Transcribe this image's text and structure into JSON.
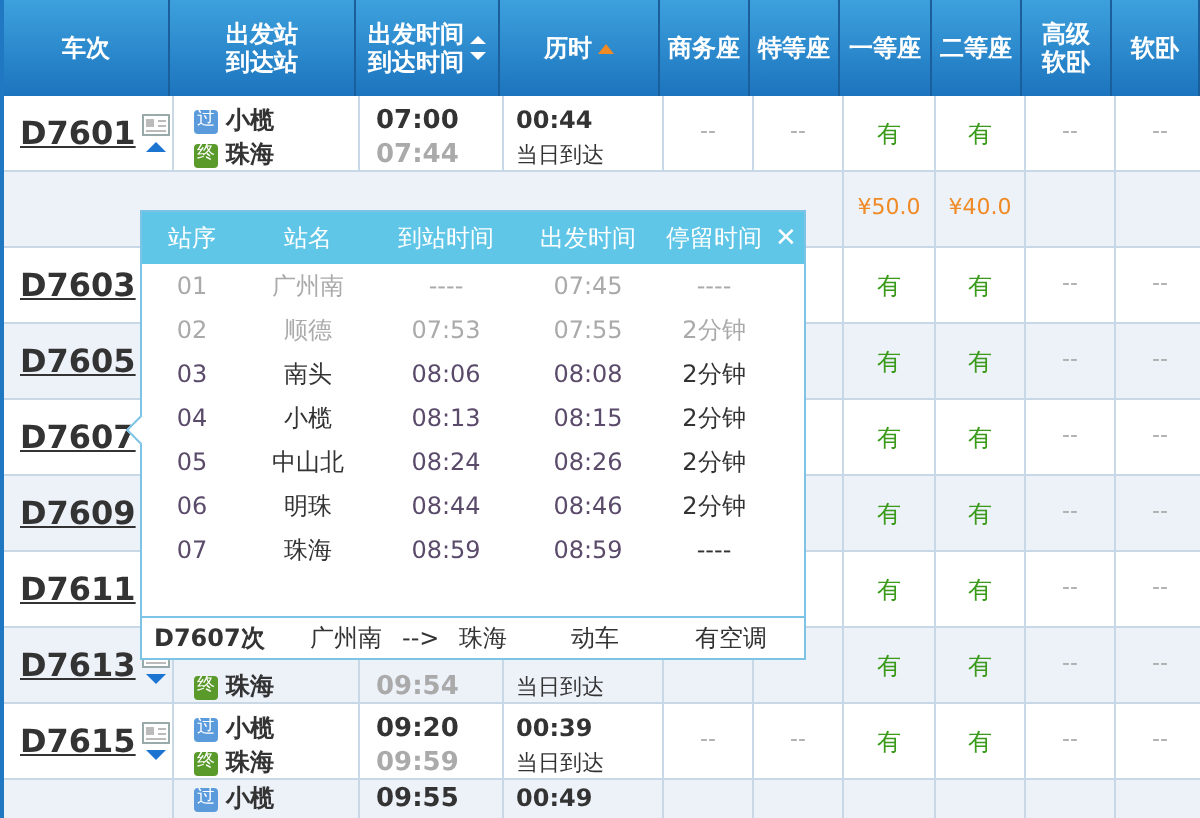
{
  "columns": [
    {
      "lines": [
        "车次"
      ]
    },
    {
      "lines": [
        "出发站",
        "到达站"
      ]
    },
    {
      "lines": [
        "出发时间",
        "到达时间"
      ],
      "sortable": true,
      "sort_active": false
    },
    {
      "lines": [
        "历时"
      ],
      "sortable": true,
      "sort_active": true
    },
    {
      "lines": [
        "商务座"
      ]
    },
    {
      "lines": [
        "特等座"
      ]
    },
    {
      "lines": [
        "一等座"
      ]
    },
    {
      "lines": [
        "二等座"
      ]
    },
    {
      "lines": [
        "高级",
        "软卧"
      ]
    },
    {
      "lines": [
        "软卧"
      ]
    }
  ],
  "rows": [
    {
      "kind": "train",
      "train": "D7601",
      "expanded": true,
      "from_badge": "过",
      "from": "小榄",
      "to_badge": "终",
      "to": "珠海",
      "depart": "07:00",
      "arrive": "07:44",
      "duration": "00:44",
      "arrival_day": "当日到达",
      "seats": [
        "--",
        "--",
        "有",
        "有",
        "--",
        "--"
      ]
    },
    {
      "kind": "price",
      "first_class": "¥50.0",
      "second_class": "¥40.0"
    },
    {
      "kind": "train",
      "train": "D7603",
      "seats": [
        "有",
        "有",
        "--",
        "--"
      ]
    },
    {
      "kind": "train",
      "train": "D7605",
      "seats": [
        "有",
        "有",
        "--",
        "--"
      ]
    },
    {
      "kind": "train",
      "train": "D7607",
      "seats": [
        "有",
        "有",
        "--",
        "--"
      ]
    },
    {
      "kind": "train",
      "train": "D7609",
      "seats": [
        "有",
        "有",
        "--",
        "--"
      ]
    },
    {
      "kind": "train",
      "train": "D7611",
      "seats": [
        "有",
        "有",
        "--",
        "--"
      ]
    },
    {
      "kind": "train",
      "train": "D7613",
      "to_badge": "终",
      "to": "珠海",
      "arrive": "09:54",
      "arrival_day": "当日到达",
      "seats": [
        "有",
        "有",
        "--",
        "--"
      ]
    },
    {
      "kind": "train",
      "train": "D7615",
      "expanded": false,
      "from_badge": "过",
      "from": "小榄",
      "to_badge": "终",
      "to": "珠海",
      "depart": "09:20",
      "arrive": "09:59",
      "duration": "00:39",
      "arrival_day": "当日到达",
      "seats": [
        "--",
        "--",
        "有",
        "有",
        "--",
        "--"
      ]
    },
    {
      "kind": "partial",
      "from_badge": "过",
      "from": "小榄",
      "depart": "09:55",
      "duration": "00:49"
    }
  ],
  "stops_popup": {
    "columns": [
      "站序",
      "站名",
      "到站时间",
      "出发时间",
      "停留时间"
    ],
    "close": "✕",
    "stops": [
      {
        "no": "01",
        "station": "广州南",
        "arrive": "----",
        "depart": "07:45",
        "stay": "----",
        "passed": true
      },
      {
        "no": "02",
        "station": "顺德",
        "arrive": "07:53",
        "depart": "07:55",
        "stay": "2分钟",
        "passed": true
      },
      {
        "no": "03",
        "station": "南头",
        "arrive": "08:06",
        "depart": "08:08",
        "stay": "2分钟",
        "passed": false
      },
      {
        "no": "04",
        "station": "小榄",
        "arrive": "08:13",
        "depart": "08:15",
        "stay": "2分钟",
        "passed": false
      },
      {
        "no": "05",
        "station": "中山北",
        "arrive": "08:24",
        "depart": "08:26",
        "stay": "2分钟",
        "passed": false
      },
      {
        "no": "06",
        "station": "明珠",
        "arrive": "08:44",
        "depart": "08:46",
        "stay": "2分钟",
        "passed": false
      },
      {
        "no": "07",
        "station": "珠海",
        "arrive": "08:59",
        "depart": "08:59",
        "stay": "----",
        "passed": false
      }
    ],
    "footer": {
      "train": "D7607次",
      "from": "广州南",
      "arrow": "-->",
      "to": "珠海",
      "type": "动车",
      "feature": "有空调"
    }
  }
}
